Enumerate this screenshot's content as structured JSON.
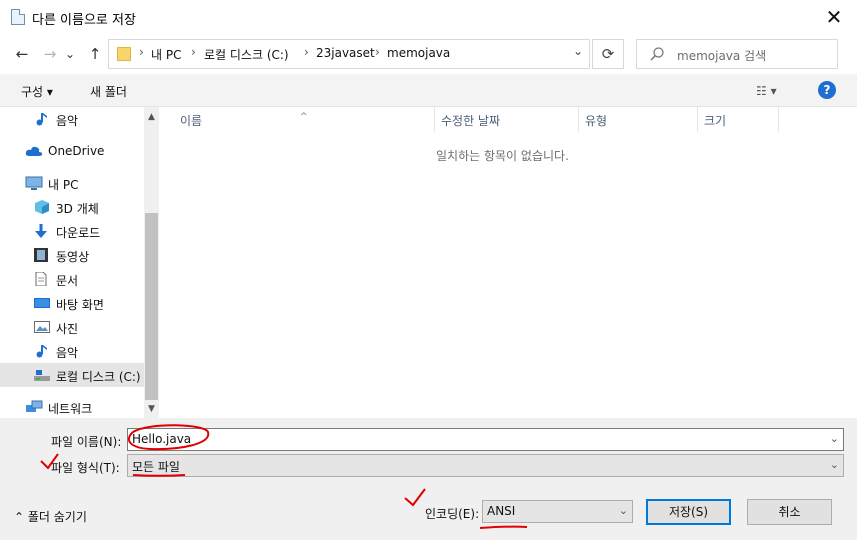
{
  "window": {
    "title": "다른 이름으로 저장",
    "close_glyph": "✕"
  },
  "nav": {
    "back_glyph": "←",
    "forward_glyph": "→",
    "recent_glyph": "⌄",
    "up_glyph": "↑",
    "breadcrumb": [
      "내 PC",
      "로컬 디스크 (C:)",
      "23javaset",
      "memojava"
    ],
    "sep_glyph": "›",
    "refresh_glyph": "⟳",
    "search_placeholder": "memojava 검색"
  },
  "cmdbar": {
    "organize": "구성 ▾",
    "new_folder": "새 폴더",
    "view_glyph": "☷ ▾",
    "help_glyph": "?"
  },
  "sidebar": {
    "items": [
      {
        "label": "음악",
        "icon": "music-note-icon"
      },
      {
        "label": "OneDrive",
        "icon": "cloud-icon"
      },
      {
        "label": "내 PC",
        "icon": "computer-icon"
      },
      {
        "label": "3D 개체",
        "icon": "cube-icon"
      },
      {
        "label": "다운로드",
        "icon": "download-icon"
      },
      {
        "label": "동영상",
        "icon": "film-icon"
      },
      {
        "label": "문서",
        "icon": "document-icon"
      },
      {
        "label": "바탕 화면",
        "icon": "desktop-icon"
      },
      {
        "label": "사진",
        "icon": "picture-icon"
      },
      {
        "label": "음악",
        "icon": "music-note-icon"
      },
      {
        "label": "로컬 디스크 (C:)",
        "icon": "drive-icon"
      },
      {
        "label": "네트워크",
        "icon": "network-icon"
      }
    ]
  },
  "filelist": {
    "columns": [
      "이름",
      "수정한 날짜",
      "유형",
      "크기"
    ],
    "sort_caret": "^",
    "empty_message": "일치하는 항목이 없습니다."
  },
  "form": {
    "filename_label": "파일 이름(N):",
    "filename_value": "Hello.java",
    "filetype_label": "파일 형식(T):",
    "filetype_value": "모든 파일",
    "encoding_label": "인코딩(E):",
    "encoding_value": "ANSI",
    "drop_glyph": "⌄"
  },
  "buttons": {
    "save": "저장(S)",
    "cancel": "취소",
    "hide_folders": "⌃  폴더 숨기기"
  },
  "colors": {
    "accent": "#0078d7",
    "annotation": "#e00000"
  }
}
